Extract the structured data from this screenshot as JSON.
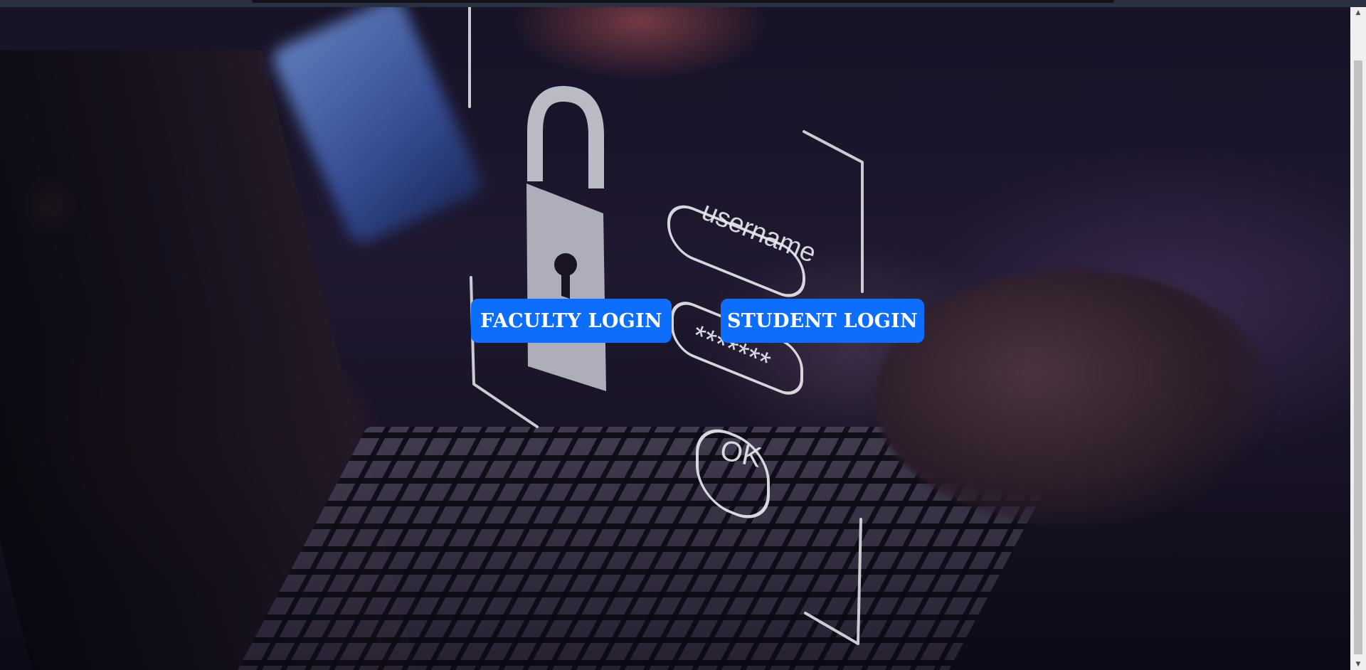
{
  "page": {
    "background_image": "laptop-login-security-hologram",
    "buttons": {
      "faculty_login": "FACULTY LOGIN",
      "student_login": "STUDENT LOGIN"
    },
    "hologram": {
      "username_label": "username",
      "password_mask": "*******",
      "ok_label": "OK"
    },
    "colors": {
      "button_bg": "#0d6efd",
      "button_text": "#ffffff"
    }
  },
  "scrollbar": {
    "up_arrow": "▲",
    "down_arrow": "▼"
  }
}
